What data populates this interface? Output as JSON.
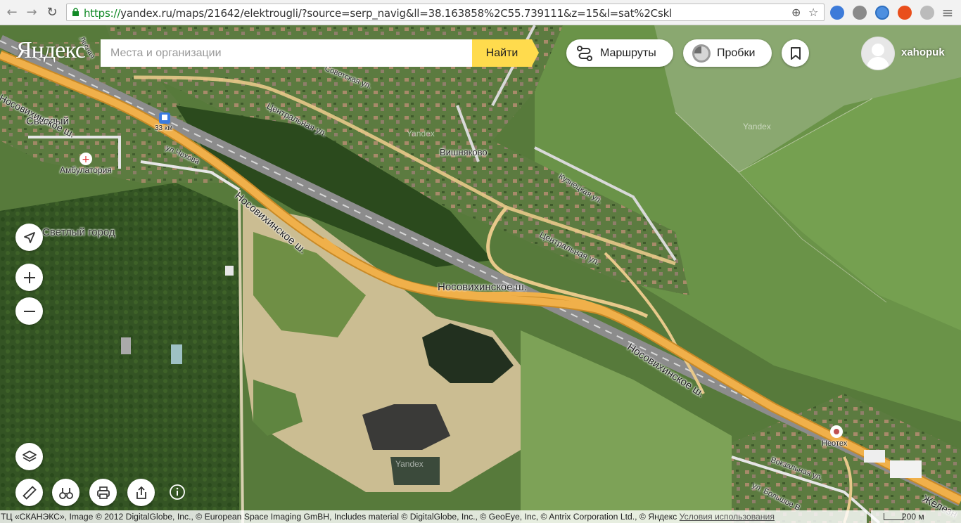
{
  "browser": {
    "url_scheme": "https://",
    "url_rest": "yandex.ru/maps/21642/elektrougli/?source=serp_navig&ll=38.163858%2C55.739111&z=15&l=sat%2Cskl"
  },
  "header": {
    "logo": "Яндекс",
    "search_placeholder": "Места и организации",
    "find_button": "Найти",
    "routes_button": "Маршруты",
    "traffic_button": "Пробки",
    "username": "xahopuk"
  },
  "map": {
    "labels": {
      "svetly": "Светлый",
      "svetly_gorod": "Светлый город",
      "ambulatory": "Амбулатория",
      "chekhova": "ул.Чехова",
      "station_km": "33 км",
      "vishnyakovo": "Вишняково",
      "sovetskaya": "Советская ул.",
      "tsentralnaya_1": "Центральная ул.",
      "tsentralnaya_2": "Центральная ул.",
      "kuznetskaya": "Кузнецкая ул.",
      "nosov_1": "Носовихинское ш.",
      "nosov_2": "Носовихинское ш.",
      "nosov_3": "Носовихинское ш.",
      "nosov_4": "Носовихинское ш.",
      "neoteh": "Неотех",
      "vokzalnaya": "Вокзальная ул.",
      "bolshoy": "ул. Большое В",
      "zhelezn": "Железн",
      "lesnaya": "Лесная",
      "watermark": "Yandex"
    }
  },
  "footer": {
    "copyright": "ТЦ «СКАНЭКС», Image © 2012 DigitalGlobe, Inc., © European Space Imaging GmBH, Includes material © DigitalGlobe, Inc., © GeoEye, Inc, © Antrix Corporation Ltd., © Яндекс",
    "terms_link": "Условия использования",
    "scale": "200 м"
  },
  "colors": {
    "search_button": "#ffdb4d",
    "highway": "#f0b04a",
    "road": "#e8c98a",
    "secure_url": "#118a26"
  }
}
